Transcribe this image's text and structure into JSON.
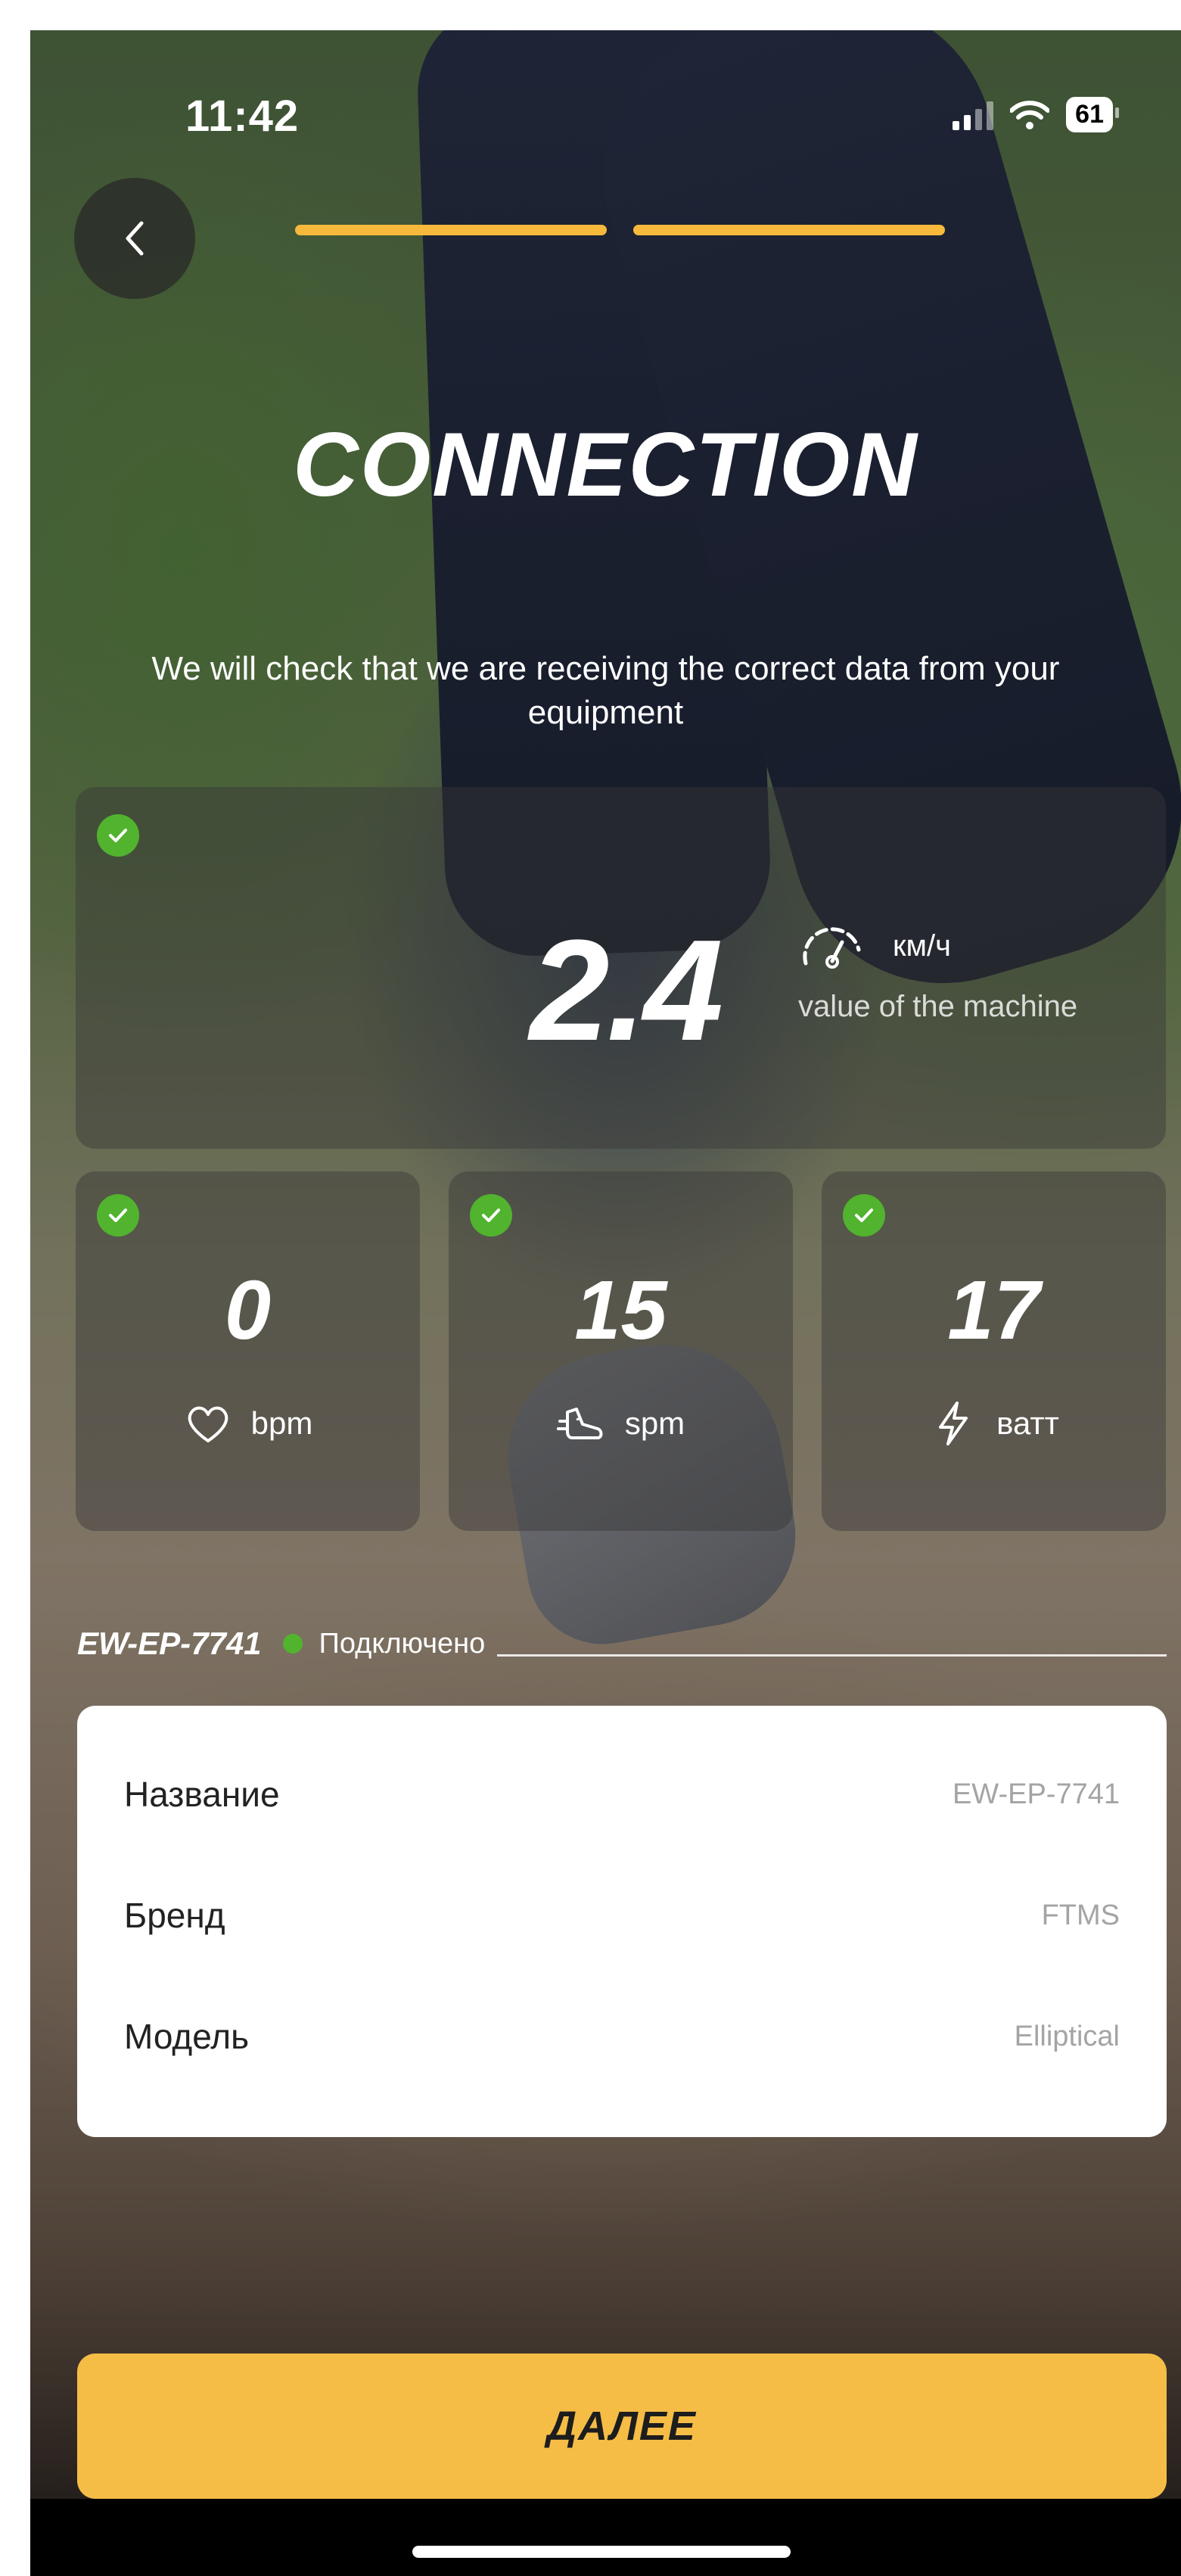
{
  "status_bar": {
    "time": "11:42",
    "battery": "61"
  },
  "header": {
    "back_icon": "chevron-left-icon",
    "progress_steps": 2,
    "progress_color": "#f6b93b",
    "title": "CONNECTION",
    "subtitle": "We will check that we are receiving the correct data from your equipment"
  },
  "speed_card": {
    "status_icon": "check-icon",
    "value": "2.4",
    "unit_icon": "speedometer-icon",
    "unit": "км/ч",
    "label": "value of the machine"
  },
  "metrics": [
    {
      "value": "0",
      "icon": "heart-icon",
      "unit": "bpm"
    },
    {
      "value": "15",
      "icon": "shoe-icon",
      "unit": "spm"
    },
    {
      "value": "17",
      "icon": "lightning-icon",
      "unit": "ватт"
    }
  ],
  "device": {
    "name": "EW-EP-7741",
    "status": "Подключено",
    "status_color": "#52b32e"
  },
  "info": [
    {
      "label": "Название",
      "value": "EW-EP-7741"
    },
    {
      "label": "Бренд",
      "value": "FTMS"
    },
    {
      "label": "Модель",
      "value": "Elliptical"
    }
  ],
  "footer": {
    "next_label": "ДАЛЕЕ",
    "button_color": "#f5bd46"
  }
}
